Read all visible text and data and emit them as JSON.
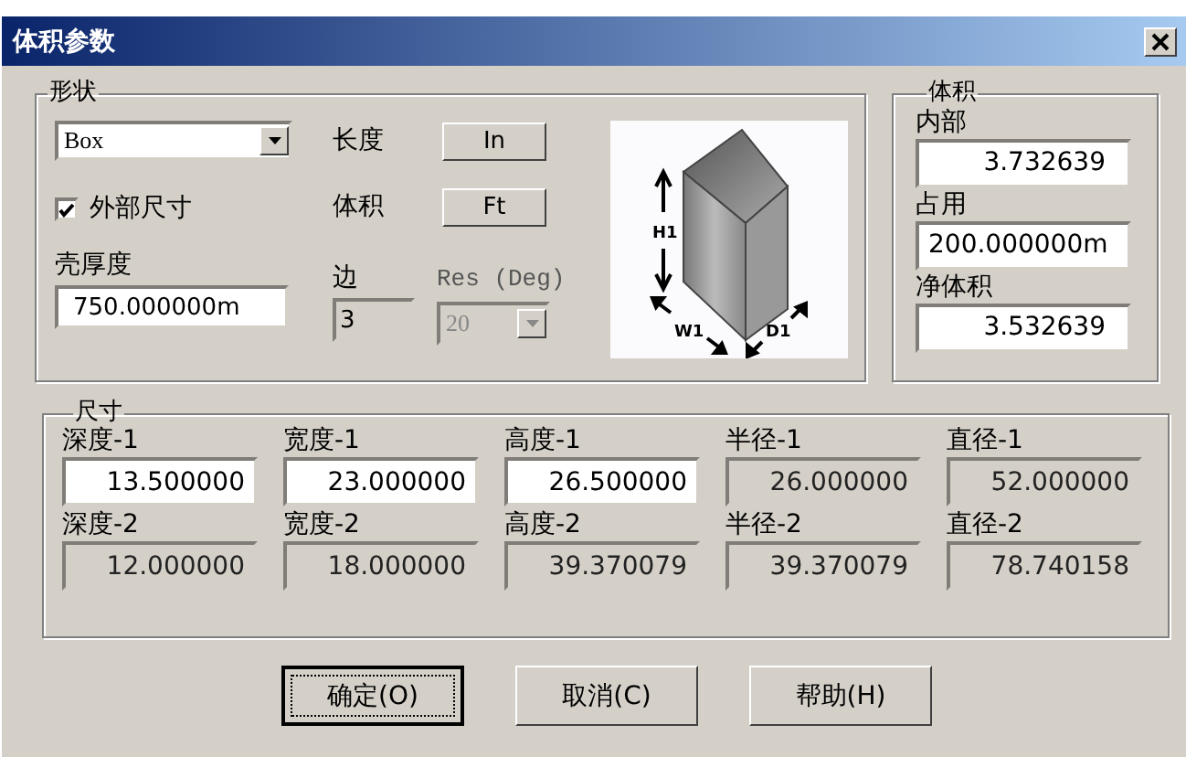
{
  "window": {
    "title": "体积参数"
  },
  "shape_group": {
    "title": "形状",
    "shape_select": {
      "value": "Box"
    },
    "outside_dims": {
      "label": "外部尺寸",
      "checked": true
    },
    "shell_thickness": {
      "label": "壳厚度",
      "value": "750.000000m"
    },
    "length_units": {
      "label": "长度",
      "button": "In"
    },
    "volume_units": {
      "label": "体积",
      "button": "Ft"
    },
    "sides": {
      "label": "边",
      "value": "3",
      "disabled": true
    },
    "resolution": {
      "label": "Res (Deg)",
      "value": "20",
      "disabled": true
    },
    "diagram_labels": [
      "H1",
      "W1",
      "D1"
    ]
  },
  "volume_group": {
    "title": "体积",
    "fields": [
      {
        "label": "内部",
        "value": "3.732639"
      },
      {
        "label": "占用",
        "value": "200.000000m"
      },
      {
        "label": "净体积",
        "value": "3.532639"
      }
    ]
  },
  "dimensions": {
    "title": "尺寸",
    "fields": [
      {
        "label": "深度-1",
        "value": "13.500000",
        "disabled": false
      },
      {
        "label": "宽度-1",
        "value": "23.000000",
        "disabled": false
      },
      {
        "label": "高度-1",
        "value": "26.500000",
        "disabled": false
      },
      {
        "label": "半径-1",
        "value": "26.000000",
        "disabled": true
      },
      {
        "label": "直径-1",
        "value": "52.000000",
        "disabled": true
      },
      {
        "label": "深度-2",
        "value": "12.000000",
        "disabled": true
      },
      {
        "label": "宽度-2",
        "value": "18.000000",
        "disabled": true
      },
      {
        "label": "高度-2",
        "value": "39.370079",
        "disabled": true
      },
      {
        "label": "半径-2",
        "value": "39.370079",
        "disabled": true
      },
      {
        "label": "直径-2",
        "value": "78.740158",
        "disabled": true
      }
    ]
  },
  "buttons": [
    {
      "label": "确定(O)",
      "default": true
    },
    {
      "label": "取消(C)",
      "default": false
    },
    {
      "label": "帮助(H)",
      "default": false
    }
  ]
}
